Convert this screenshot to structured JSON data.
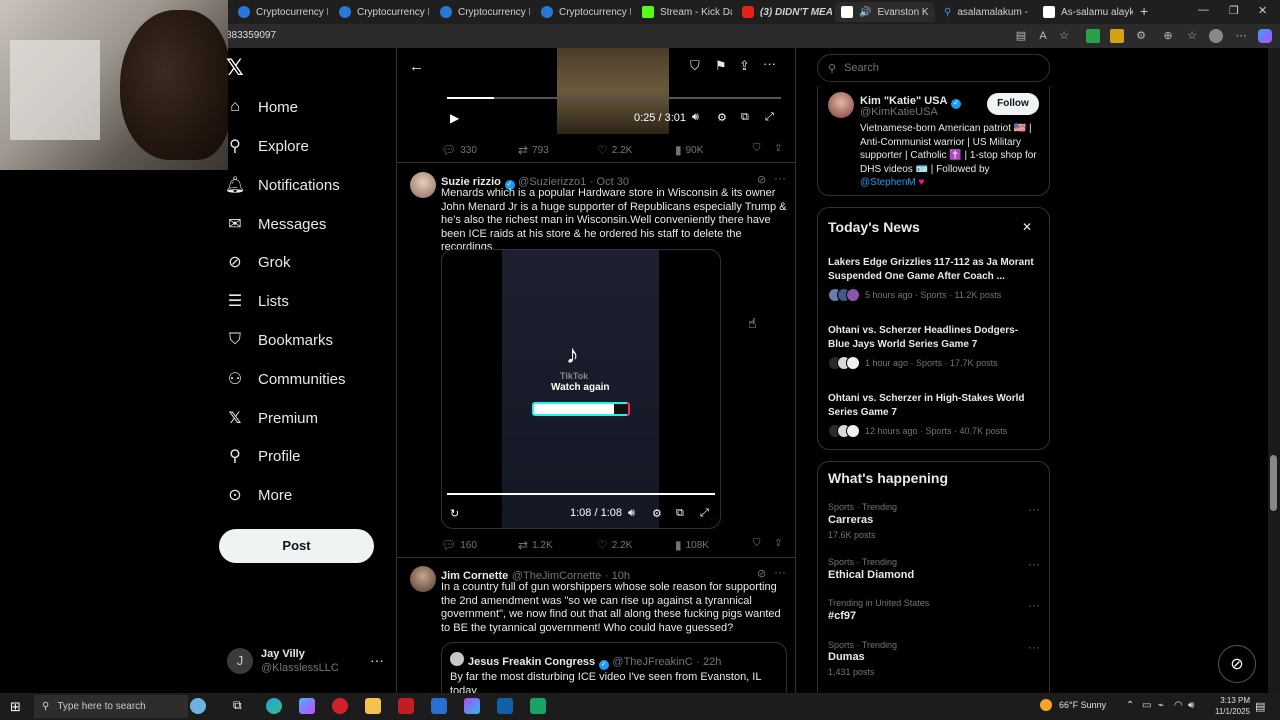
{
  "browser": {
    "tabs": [
      {
        "label": "Cryptocurrency P",
        "active": false
      },
      {
        "label": "Cryptocurrency P",
        "active": false
      },
      {
        "label": "Cryptocurrency P",
        "active": false
      },
      {
        "label": "Cryptocurrency P",
        "active": false
      },
      {
        "label": "Stream - Kick Da",
        "active": false
      },
      {
        "label": "(3) DIDN'T MEAN",
        "active": false
      },
      {
        "label": "Evanston K",
        "active": true
      },
      {
        "label": "asalamalakum -",
        "active": false
      },
      {
        "label": "As-salamu alayk",
        "active": false
      }
    ],
    "address": "883359097",
    "new_tab_symbol": "+"
  },
  "nav": {
    "items": [
      {
        "label": "Home",
        "icon": "home-icon"
      },
      {
        "label": "Explore",
        "icon": "search-icon"
      },
      {
        "label": "Notifications",
        "icon": "bell-icon"
      },
      {
        "label": "Messages",
        "icon": "mail-icon"
      },
      {
        "label": "Grok",
        "icon": "grok-icon"
      },
      {
        "label": "Lists",
        "icon": "list-icon"
      },
      {
        "label": "Bookmarks",
        "icon": "bookmark-icon"
      },
      {
        "label": "Communities",
        "icon": "people-icon"
      },
      {
        "label": "Premium",
        "icon": "x-icon"
      },
      {
        "label": "Profile",
        "icon": "person-icon"
      },
      {
        "label": "More",
        "icon": "more-icon"
      }
    ],
    "post_label": "Post",
    "account": {
      "initial": "J",
      "name": "Jay Villy",
      "handle": "@KlasslessLLC",
      "dots": "···"
    }
  },
  "feed": {
    "video1": {
      "time": "0:25 / 3:01",
      "progress": 0.14
    },
    "video1_stats": {
      "replies": "330",
      "reposts": "793",
      "likes": "2.2K",
      "views": "90K"
    },
    "tweet2": {
      "name": "Suzie rizzio",
      "handle": "@Suzierizzo1",
      "date": "· Oct 30",
      "text": "Menards which is a popular Hardware store in Wisconsin & its owner John Menard Jr is a huge supporter of Republicans especially Trump & he's also the richest man in Wisconsin.Well conveniently there have been ICE raids at his store & he ordered his staff to delete the recordings.",
      "video_overlay": "Watch again",
      "tiktok_label": "TikTok",
      "video_time": "1:08 / 1:08",
      "video_progress": 1.0,
      "stats": {
        "replies": "160",
        "reposts": "1.2K",
        "likes": "2.2K",
        "views": "108K"
      }
    },
    "tweet3": {
      "name": "Jim Cornette",
      "handle": "@TheJimCornette",
      "date": "· 10h",
      "text": "In a country full of gun worshippers whose sole reason for supporting the 2nd amendment was \"so we can rise up against a tyrannical government\", we now find out that all along these fucking pigs wanted to BE the tyrannical government! Who could have guessed?",
      "quote": {
        "name": "Jesus Freakin Congress",
        "handle": "@TheJFreakinC",
        "date": "· 22h",
        "text": "By far the most disturbing ICE video I've seen from Evanston, IL today."
      }
    }
  },
  "right": {
    "search_placeholder": "Search",
    "profile_card": {
      "name": "Kim \"Katie\" USA",
      "handle": "@KimKatieUSA",
      "follow_label": "Follow",
      "bio": "Vietnamese-born American patriot 🇺🇸 | Anti-Communist warrior | US Military supporter | Catholic ✝️ | 1-stop shop for DHS videos 🪪 | Followed by",
      "bio_link": "@StephenM",
      "bio_heart": "♥"
    },
    "news": {
      "title": "Today's News",
      "items": [
        {
          "title": "Lakers Edge Grizzlies 117-112 as Ja Morant Suspended One Game After Coach ...",
          "meta": "5 hours ago · Sports · 11.2K posts"
        },
        {
          "title": "Ohtani vs. Scherzer Headlines Dodgers-Blue Jays World Series Game 7",
          "meta": "1 hour ago · Sports · 17.7K posts"
        },
        {
          "title": "Ohtani vs. Scherzer in High-Stakes World Series Game 7",
          "meta": "12 hours ago · Sports · 40.7K posts"
        }
      ]
    },
    "happening": {
      "title": "What's happening",
      "items": [
        {
          "category": "Sports · Trending",
          "title": "Carreras",
          "count": "17.6K posts"
        },
        {
          "category": "Sports · Trending",
          "title": "Ethical Diamond",
          "count": ""
        },
        {
          "category": "Trending in United States",
          "title": "#cf97",
          "count": ""
        },
        {
          "category": "Sports · Trending",
          "title": "Dumas",
          "count": "1,431 posts"
        }
      ]
    }
  },
  "taskbar": {
    "search_placeholder": "Type here to search",
    "weather": "66°F  Sunny",
    "time": "3:13 PM",
    "date": "11/1/2025"
  },
  "colors": {
    "accent": "#1d9bf0",
    "bg": "#000000",
    "border": "#2f3336",
    "muted": "#71767b"
  }
}
